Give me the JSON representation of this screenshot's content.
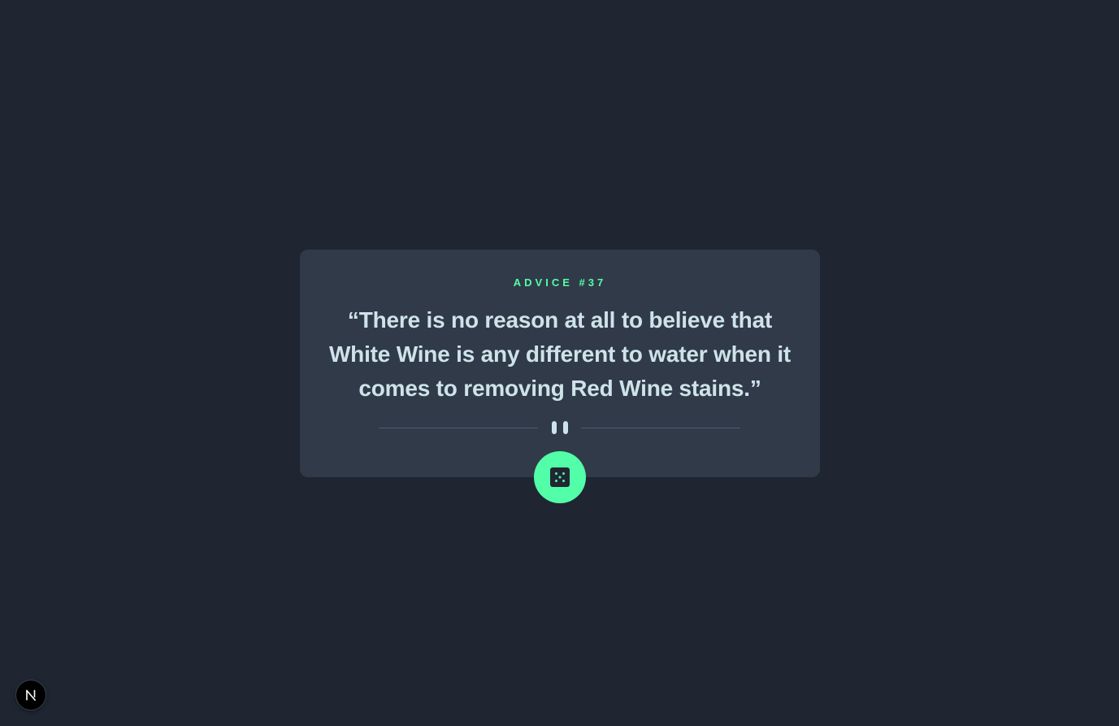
{
  "advice": {
    "id_label": "ADVICE #37",
    "quote": "“There is no reason at all to believe that White Wine is any different to water when it comes to removing Red Wine stains.”"
  },
  "button": {
    "icon": "dice-icon"
  },
  "badge": {
    "icon": "nextjs-logo-icon",
    "letter": "N"
  },
  "colors": {
    "background": "#1f2632",
    "card": "#313a48",
    "accent": "#52ffa8",
    "text": "#cee3e9",
    "divider": "#4f5d74"
  }
}
